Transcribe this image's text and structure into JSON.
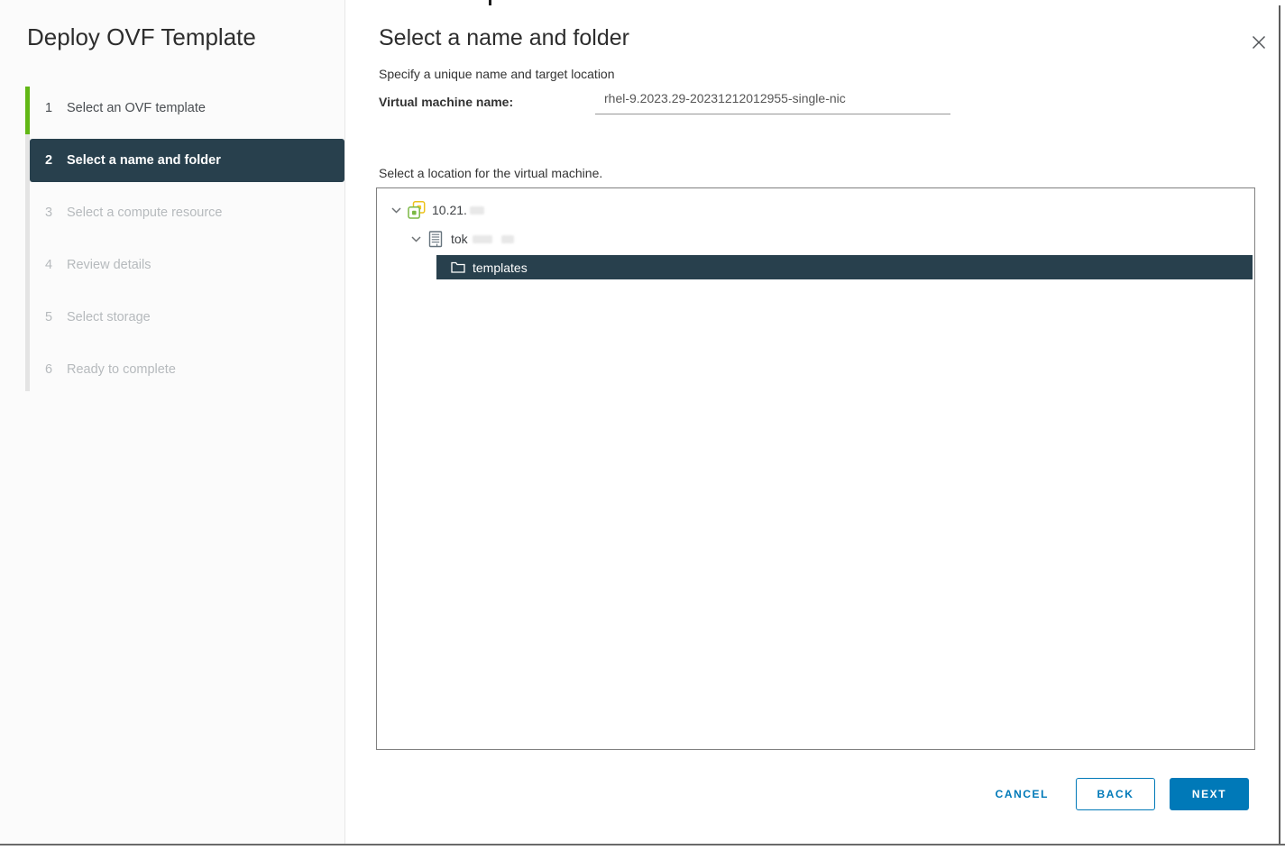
{
  "wizard": {
    "title": "Deploy OVF Template"
  },
  "steps": [
    {
      "number": "1",
      "label": "Select an OVF template",
      "state": "completed"
    },
    {
      "number": "2",
      "label": "Select a name and folder",
      "state": "active"
    },
    {
      "number": "3",
      "label": "Select a compute resource",
      "state": "pending"
    },
    {
      "number": "4",
      "label": "Review details",
      "state": "pending"
    },
    {
      "number": "5",
      "label": "Select storage",
      "state": "pending"
    },
    {
      "number": "6",
      "label": "Ready to complete",
      "state": "pending"
    }
  ],
  "page": {
    "title": "Select a name and folder",
    "subtitle": "Specify a unique name and target location",
    "vm_name_label": "Virtual machine name:",
    "vm_name_value": "rhel-9.2023.29-20231212012955-single-nic",
    "location_label": "Select a location for the virtual machine."
  },
  "tree": {
    "rows": [
      {
        "label": "10.21.",
        "icon": "vcenter-icon",
        "expanded": true,
        "redacted": true
      },
      {
        "label": "tok",
        "icon": "datacenter-icon",
        "expanded": true,
        "redacted": true
      },
      {
        "label": "templates",
        "icon": "folder-icon",
        "selected": true
      }
    ]
  },
  "footer": {
    "cancel_label": "CANCEL",
    "back_label": "BACK",
    "next_label": "NEXT"
  },
  "colors": {
    "accent_blue": "#0079b8",
    "selection_dark": "#28404d",
    "progress_green": "#61b715"
  }
}
